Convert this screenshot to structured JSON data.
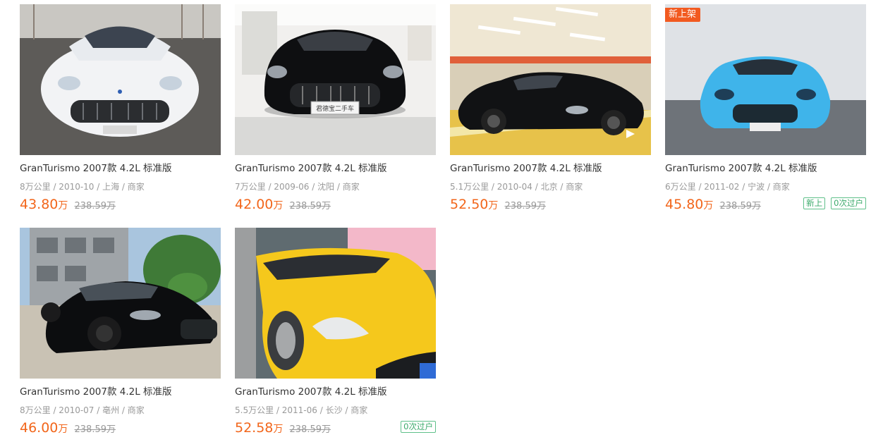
{
  "colors": {
    "price": "#f2661b",
    "badge_green": "#3aa96a",
    "tag_orange": "#f25a20"
  },
  "listings": [
    {
      "title": "GranTurismo 2007款 4.2L 标准版",
      "meta": "8万公里 / 2010-10 / 上海 / 商家",
      "price": "43.80",
      "unit": "万",
      "original_price": "238.59万",
      "tag": "",
      "badges": [],
      "image": "white-maserati-front"
    },
    {
      "title": "GranTurismo 2007款 4.2L 标准版",
      "meta": "7万公里 / 2009-06 / 沈阳 / 商家",
      "price": "42.00",
      "unit": "万",
      "original_price": "238.59万",
      "tag": "",
      "badges": [],
      "image": "black-maserati-showroom",
      "plate_text": "君德宝二手车"
    },
    {
      "title": "GranTurismo 2007款 4.2L 标准版",
      "meta": "5.1万公里 / 2010-04 / 北京 / 商家",
      "price": "52.50",
      "unit": "万",
      "original_price": "238.59万",
      "tag": "",
      "badges": [],
      "image": "black-maserati-garage"
    },
    {
      "title": "GranTurismo 2007款 4.2L 标准版",
      "meta": "6万公里 / 2011-02 / 宁波 / 商家",
      "price": "45.80",
      "unit": "万",
      "original_price": "238.59万",
      "tag": "新上架",
      "badges": [
        "新上",
        "0次过户"
      ],
      "image": "blue-maserati-studio"
    },
    {
      "title": "GranTurismo 2007款 4.2L 标准版",
      "meta": "8万公里 / 2010-07 / 亳州 / 商家",
      "price": "46.00",
      "unit": "万",
      "original_price": "238.59万",
      "tag": "",
      "badges": [],
      "image": "black-maserati-outdoor"
    },
    {
      "title": "GranTurismo 2007款 4.2L 标准版",
      "meta": "5.5万公里 / 2011-06 / 长沙 / 商家",
      "price": "52.58",
      "unit": "万",
      "original_price": "238.59万",
      "tag": "",
      "badges": [
        "0次过户"
      ],
      "image": "yellow-maserati-closeup"
    }
  ]
}
